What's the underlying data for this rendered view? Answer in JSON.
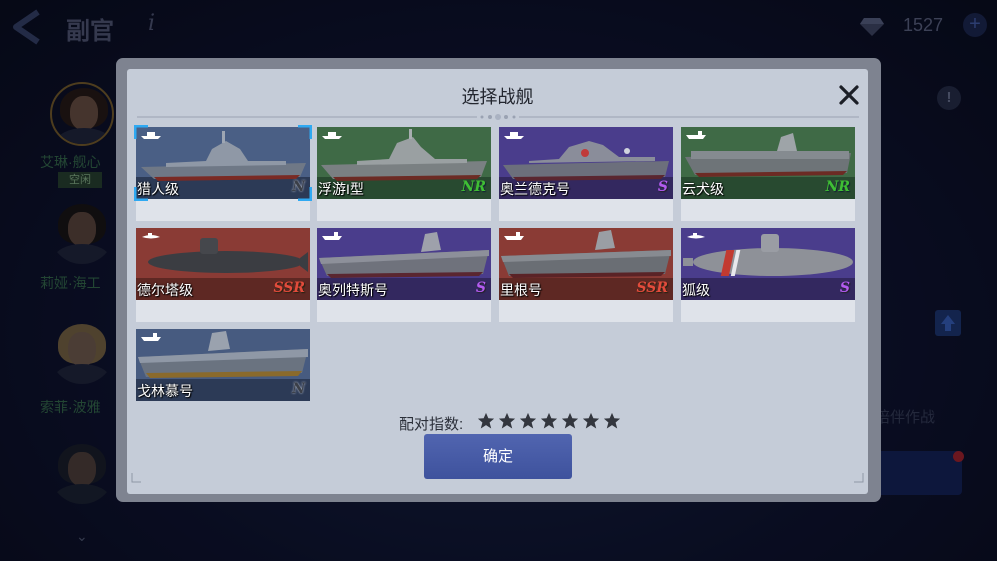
{
  "header": {
    "title": "副官",
    "info_symbol": "i",
    "gems": "1527",
    "add_symbol": "+"
  },
  "officers": [
    {
      "name": "艾琳·舰心",
      "status": "空闲"
    },
    {
      "name": "莉娅·海工"
    },
    {
      "name": "索菲·波雅"
    }
  ],
  "side_panel": {
    "hint_symbol": "!",
    "escort_text": "陪伴作战"
  },
  "modal": {
    "title": "选择战舰",
    "match_label": "配对指数:",
    "match_stars": 7,
    "confirm_label": "确定",
    "ships": [
      {
        "name": "猎人级",
        "rarity": "N",
        "selected": true
      },
      {
        "name": "浮游I型",
        "rarity": "NR"
      },
      {
        "name": "奥兰德克号",
        "rarity": "S"
      },
      {
        "name": "云犬级",
        "rarity": "NR"
      },
      {
        "name": "德尔塔级",
        "rarity": "SSR"
      },
      {
        "name": "奥列特斯号",
        "rarity": "S"
      },
      {
        "name": "里根号",
        "rarity": "SSR"
      },
      {
        "name": "狐级",
        "rarity": "S"
      },
      {
        "name": "戈林慕号",
        "rarity": "N"
      }
    ]
  },
  "colors": {
    "rarity_N_bg": "#475b80",
    "rarity_NR_bg": "#3f6a46",
    "rarity_S_bg": "#4a3d8c",
    "rarity_SSR_bg": "#8a3b35",
    "confirm": "#4257a0",
    "select": "#2fa9f2"
  }
}
